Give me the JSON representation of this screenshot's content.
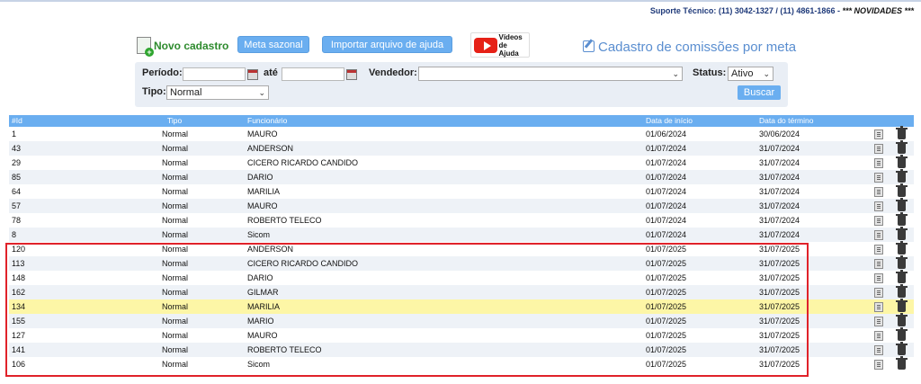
{
  "header": {
    "support_label": "Suporte Técnico: (11) 3042-1327 / (11) 4861-1866 -",
    "news_label": "*** NOVIDADES ***"
  },
  "toolbar": {
    "novo_cadastro": "Novo cadastro",
    "meta_sazonal": "Meta sazonal",
    "importar": "Importar arquivo de ajuda",
    "videos_line1": "Vídeos",
    "videos_line2": "de Ajuda",
    "youtube_label": "YouTube",
    "page_title": "Cadastro de comissões por meta"
  },
  "filters": {
    "periodo_label": "Período:",
    "ate_label": "até",
    "vendedor_label": "Vendedor:",
    "status_label": "Status:",
    "status_value": "Ativo",
    "tipo_label": "Tipo:",
    "tipo_value": "Normal",
    "buscar": "Buscar"
  },
  "table": {
    "headers": {
      "id": "#Id",
      "tipo": "Tipo",
      "func": "Funcionário",
      "ini": "Data de início",
      "fim": "Data do término"
    },
    "rows": [
      {
        "id": "1",
        "tipo": "Normal",
        "func": "MAURO",
        "ini": "01/06/2024",
        "fim": "30/06/2024"
      },
      {
        "id": "43",
        "tipo": "Normal",
        "func": "ANDERSON",
        "ini": "01/07/2024",
        "fim": "31/07/2024"
      },
      {
        "id": "29",
        "tipo": "Normal",
        "func": "CICERO RICARDO CANDIDO",
        "ini": "01/07/2024",
        "fim": "31/07/2024"
      },
      {
        "id": "85",
        "tipo": "Normal",
        "func": "DARIO",
        "ini": "01/07/2024",
        "fim": "31/07/2024"
      },
      {
        "id": "64",
        "tipo": "Normal",
        "func": "MARILIA",
        "ini": "01/07/2024",
        "fim": "31/07/2024"
      },
      {
        "id": "57",
        "tipo": "Normal",
        "func": "MAURO",
        "ini": "01/07/2024",
        "fim": "31/07/2024"
      },
      {
        "id": "78",
        "tipo": "Normal",
        "func": "ROBERTO TELECO",
        "ini": "01/07/2024",
        "fim": "31/07/2024"
      },
      {
        "id": "8",
        "tipo": "Normal",
        "func": "Sicom",
        "ini": "01/07/2024",
        "fim": "31/07/2024"
      },
      {
        "id": "120",
        "tipo": "Normal",
        "func": "ANDERSON",
        "ini": "01/07/2025",
        "fim": "31/07/2025"
      },
      {
        "id": "113",
        "tipo": "Normal",
        "func": "CICERO RICARDO CANDIDO",
        "ini": "01/07/2025",
        "fim": "31/07/2025"
      },
      {
        "id": "148",
        "tipo": "Normal",
        "func": "DARIO",
        "ini": "01/07/2025",
        "fim": "31/07/2025"
      },
      {
        "id": "162",
        "tipo": "Normal",
        "func": "GILMAR",
        "ini": "01/07/2025",
        "fim": "31/07/2025"
      },
      {
        "id": "134",
        "tipo": "Normal",
        "func": "MARILIA",
        "ini": "01/07/2025",
        "fim": "31/07/2025"
      },
      {
        "id": "155",
        "tipo": "Normal",
        "func": "MARIO",
        "ini": "01/07/2025",
        "fim": "31/07/2025"
      },
      {
        "id": "127",
        "tipo": "Normal",
        "func": "MAURO",
        "ini": "01/07/2025",
        "fim": "31/07/2025"
      },
      {
        "id": "141",
        "tipo": "Normal",
        "func": "ROBERTO TELECO",
        "ini": "01/07/2025",
        "fim": "31/07/2025"
      },
      {
        "id": "106",
        "tipo": "Normal",
        "func": "Sicom",
        "ini": "01/07/2025",
        "fim": "31/07/2025"
      }
    ]
  }
}
